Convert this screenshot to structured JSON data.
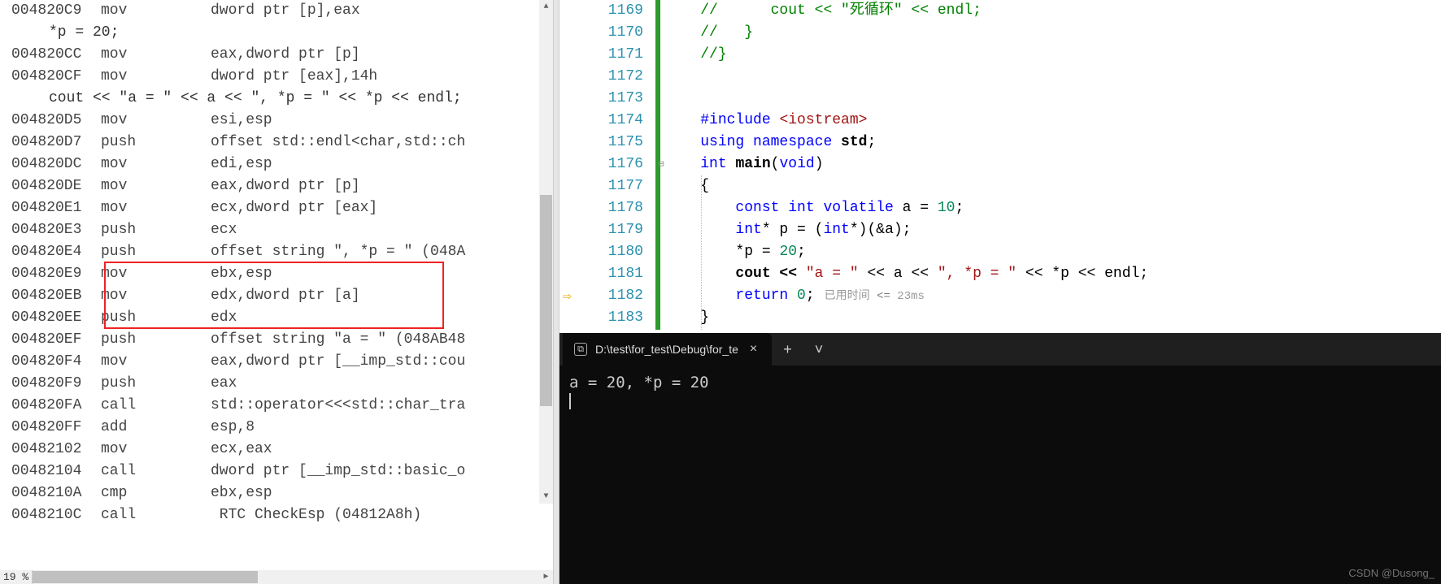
{
  "zoom": "19 %",
  "watermark": "CSDN @Dusong_",
  "disasm": {
    "rows": [
      {
        "type": "asm",
        "addr": "004820C9",
        "mnem": "mov",
        "oper": "dword ptr [p],eax"
      },
      {
        "type": "src",
        "text": "*p = 20;"
      },
      {
        "type": "asm",
        "addr": "004820CC",
        "mnem": "mov",
        "oper": "eax,dword ptr [p]"
      },
      {
        "type": "asm",
        "addr": "004820CF",
        "mnem": "mov",
        "oper": "dword ptr [eax],14h"
      },
      {
        "type": "src",
        "text": "cout << \"a = \" << a << \", *p = \" << *p << endl;"
      },
      {
        "type": "asm",
        "addr": "004820D5",
        "mnem": "mov",
        "oper": "esi,esp"
      },
      {
        "type": "asm",
        "addr": "004820D7",
        "mnem": "push",
        "oper": "offset std::endl<char,std::ch"
      },
      {
        "type": "asm",
        "addr": "004820DC",
        "mnem": "mov",
        "oper": "edi,esp"
      },
      {
        "type": "asm",
        "addr": "004820DE",
        "mnem": "mov",
        "oper": "eax,dword ptr [p]"
      },
      {
        "type": "asm",
        "addr": "004820E1",
        "mnem": "mov",
        "oper": "ecx,dword ptr [eax]"
      },
      {
        "type": "asm",
        "addr": "004820E3",
        "mnem": "push",
        "oper": "ecx"
      },
      {
        "type": "asm",
        "addr": "004820E4",
        "mnem": "push",
        "oper": "offset string \", *p = \" (048A"
      },
      {
        "type": "asm",
        "addr": "004820E9",
        "mnem": "mov",
        "oper": "ebx,esp"
      },
      {
        "type": "asm",
        "addr": "004820EB",
        "mnem": "mov",
        "oper": "edx,dword ptr [a]"
      },
      {
        "type": "asm",
        "addr": "004820EE",
        "mnem": "push",
        "oper": "edx"
      },
      {
        "type": "asm",
        "addr": "004820EF",
        "mnem": "push",
        "oper": "offset string \"a = \" (048AB48"
      },
      {
        "type": "asm",
        "addr": "004820F4",
        "mnem": "mov",
        "oper": "eax,dword ptr [__imp_std::cou"
      },
      {
        "type": "asm",
        "addr": "004820F9",
        "mnem": "push",
        "oper": "eax"
      },
      {
        "type": "asm",
        "addr": "004820FA",
        "mnem": "call",
        "oper": "std::operator<<<std::char_tra"
      },
      {
        "type": "asm",
        "addr": "004820FF",
        "mnem": "add",
        "oper": "esp,8"
      },
      {
        "type": "asm",
        "addr": "00482102",
        "mnem": "mov",
        "oper": "ecx,eax"
      },
      {
        "type": "asm",
        "addr": "00482104",
        "mnem": "call",
        "oper": "dword ptr [__imp_std::basic_o"
      },
      {
        "type": "asm",
        "addr": "0048210A",
        "mnem": "cmp",
        "oper": "ebx,esp"
      },
      {
        "type": "asm",
        "addr": "0048210C",
        "mnem": "call",
        "oper": " RTC CheckEsp (04812A8h)"
      }
    ],
    "highlight": {
      "startRow": 12,
      "endRow": 14
    }
  },
  "source": {
    "lineStart": 1169,
    "execLine": 1182,
    "timing_prefix": "已用时间 ",
    "timing_op": "<=",
    "timing_val": " 23ms",
    "lines": {
      "1169": {
        "segs": [
          {
            "t": "//      cout << \"死循环\" << endl;",
            "c": "com"
          }
        ],
        "ind": "    "
      },
      "1170": {
        "segs": [
          {
            "t": "//   }",
            "c": "com"
          }
        ],
        "ind": "    "
      },
      "1171": {
        "segs": [
          {
            "t": "//}",
            "c": "com"
          }
        ],
        "ind": "    "
      },
      "1172": {
        "segs": [],
        "ind": ""
      },
      "1173": {
        "segs": [],
        "ind": ""
      },
      "1174": {
        "segs": [
          {
            "t": "#include ",
            "c": "kw"
          },
          {
            "t": "<iostream>",
            "c": "angle"
          }
        ],
        "ind": "    "
      },
      "1175": {
        "segs": [
          {
            "t": "using namespace ",
            "c": "kw"
          },
          {
            "t": "std",
            "c": "ident bold"
          },
          {
            "t": ";",
            "c": "ident"
          }
        ],
        "ind": "    "
      },
      "1176": {
        "segs": [
          {
            "t": "int ",
            "c": "kw"
          },
          {
            "t": "main",
            "c": "ident bold"
          },
          {
            "t": "(",
            "c": "ident"
          },
          {
            "t": "void",
            "c": "kw"
          },
          {
            "t": ")",
            "c": "ident"
          }
        ],
        "ind": "    "
      },
      "1177": {
        "segs": [
          {
            "t": "{",
            "c": "ident"
          }
        ],
        "ind": "    "
      },
      "1178": {
        "segs": [
          {
            "t": "const int volatile ",
            "c": "kw"
          },
          {
            "t": "a = ",
            "c": "ident"
          },
          {
            "t": "10",
            "c": "num"
          },
          {
            "t": ";",
            "c": "ident"
          }
        ],
        "ind": "        "
      },
      "1179": {
        "segs": [
          {
            "t": "int",
            "c": "kw"
          },
          {
            "t": "* p = (",
            "c": "ident"
          },
          {
            "t": "int",
            "c": "kw"
          },
          {
            "t": "*)(&a);",
            "c": "ident"
          }
        ],
        "ind": "        "
      },
      "1180": {
        "segs": [
          {
            "t": "*p = ",
            "c": "ident"
          },
          {
            "t": "20",
            "c": "num"
          },
          {
            "t": ";",
            "c": "ident"
          }
        ],
        "ind": "        "
      },
      "1181": {
        "segs": [
          {
            "t": "cout << ",
            "c": "ident bold"
          },
          {
            "t": "\"a = \"",
            "c": "str"
          },
          {
            "t": " << a << ",
            "c": "ident"
          },
          {
            "t": "\", *p = \"",
            "c": "str"
          },
          {
            "t": " << *p << endl;",
            "c": "ident"
          }
        ],
        "ind": "        "
      },
      "1182": {
        "segs": [
          {
            "t": "return ",
            "c": "kw"
          },
          {
            "t": "0",
            "c": "num"
          },
          {
            "t": ";",
            "c": "ident"
          }
        ],
        "ind": "        ",
        "current": true
      },
      "1183": {
        "segs": [
          {
            "t": "}",
            "c": "ident"
          }
        ],
        "ind": "    "
      },
      "1184": {
        "segs": [],
        "ind": ""
      }
    }
  },
  "terminal": {
    "title": "D:\\test\\for_test\\Debug\\for_te",
    "output": "a = 20, *p = 20",
    "icon_glyph": "⧉",
    "plus": "+",
    "chevron": "˅",
    "close": "×"
  }
}
